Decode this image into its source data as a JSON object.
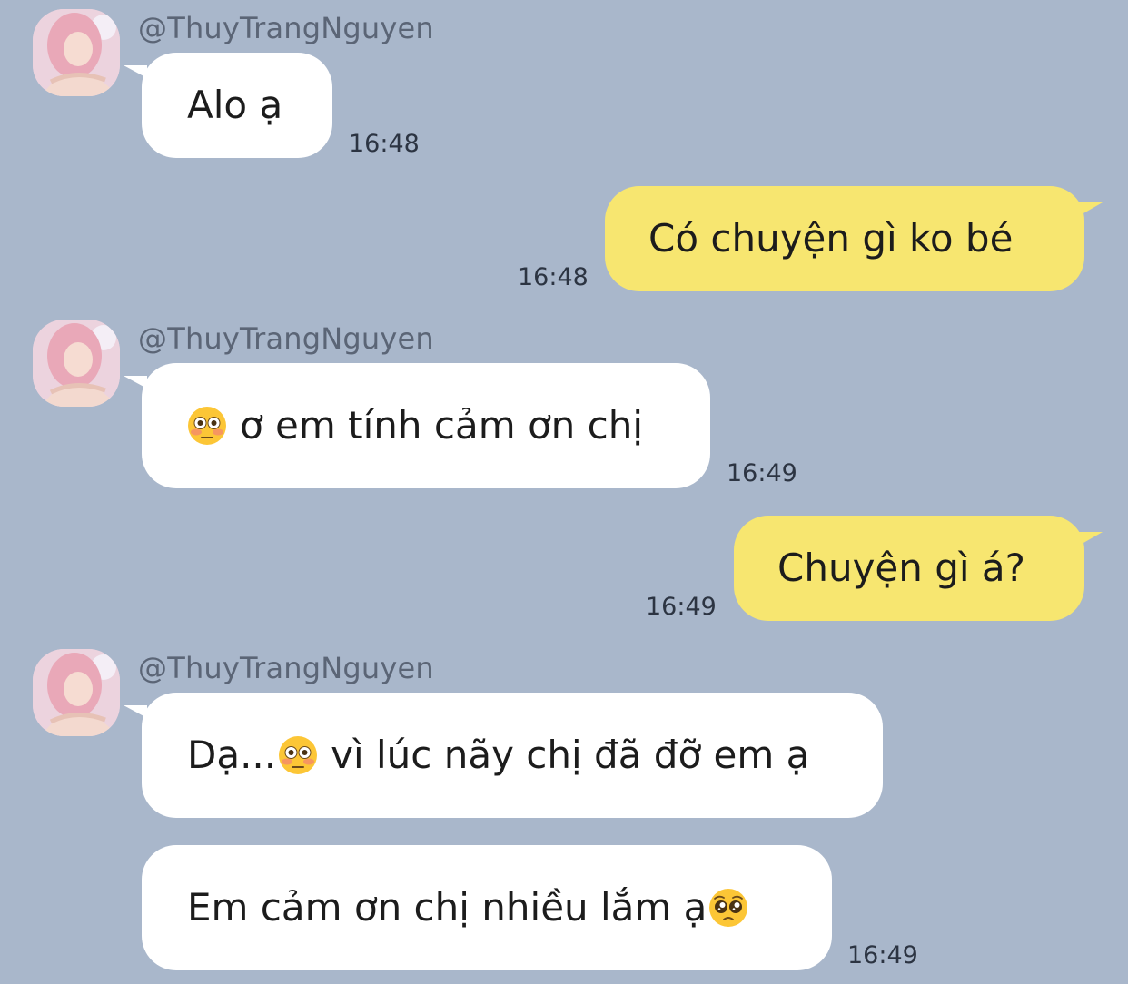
{
  "colors": {
    "background": "#a9b7cb",
    "incoming_bubble": "#ffffff",
    "outgoing_bubble": "#f7e670",
    "sender_name": "#5b6576",
    "timestamp": "#2c3442"
  },
  "messages": [
    {
      "direction": "incoming",
      "sender": "@ThuyTrangNguyen",
      "avatar": "profile-photo",
      "text": "Alo ạ",
      "time": "16:48"
    },
    {
      "direction": "outgoing",
      "text": "Có chuyện gì ko bé",
      "time": "16:48"
    },
    {
      "direction": "incoming",
      "sender": "@ThuyTrangNguyen",
      "avatar": "profile-photo",
      "emoji_before": "flushed-face-emoji",
      "text": "ơ em tính cảm ơn chị",
      "time": "16:49"
    },
    {
      "direction": "outgoing",
      "text": "Chuyện gì á?",
      "time": "16:49"
    },
    {
      "direction": "incoming",
      "sender": "@ThuyTrangNguyen",
      "avatar": "profile-photo",
      "text_before": "Dạ...",
      "emoji_inline": "flushed-face-emoji",
      "text_after": "vì lúc nãy chị đã đỡ em ạ"
    },
    {
      "direction": "incoming",
      "text": "Em cảm ơn chị nhiều lắm ạ",
      "emoji_after": "pleading-face-emoji",
      "time": "16:49"
    }
  ]
}
